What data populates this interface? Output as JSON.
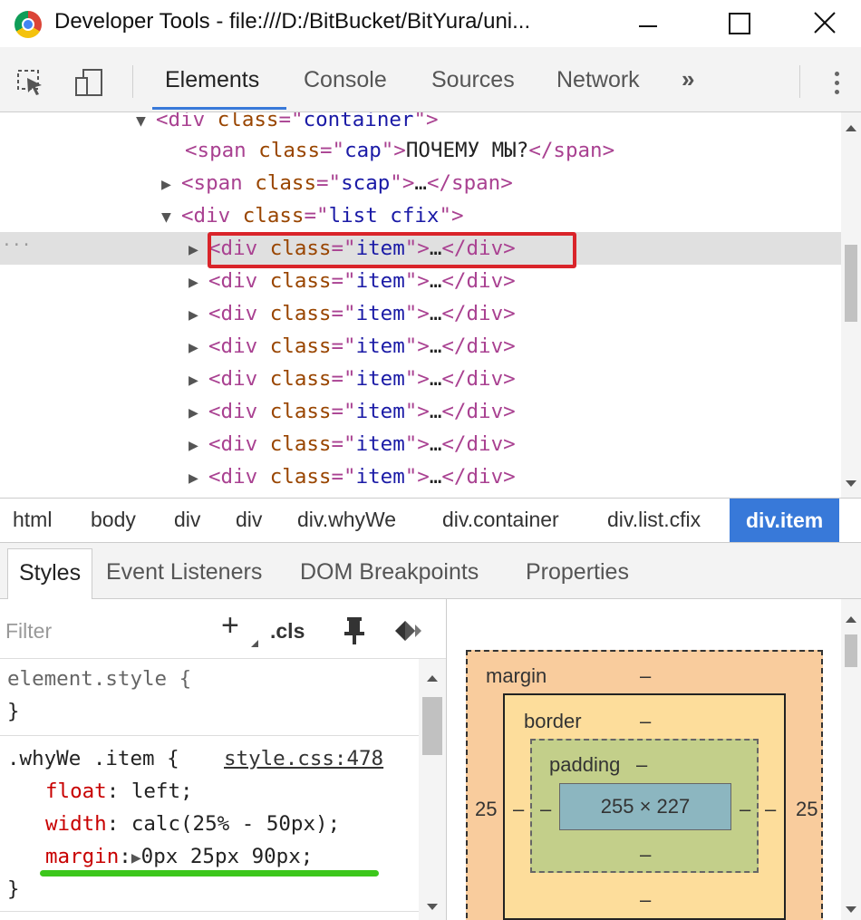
{
  "window": {
    "title": "Developer Tools - file:///D:/BitBucket/BitYura/uni...",
    "logo_icon": "chrome-logo-icon",
    "minimize_icon": "minimize-icon",
    "maximize_icon": "maximize-icon",
    "close_icon": "close-icon",
    "close_glyph": "✕"
  },
  "toolbar": {
    "tabs": [
      {
        "label": "Elements",
        "active": true
      },
      {
        "label": "Console",
        "active": false
      },
      {
        "label": "Sources",
        "active": false
      },
      {
        "label": "Network",
        "active": false
      }
    ],
    "more_tabs": "»",
    "inspect_icon": "inspect-element-icon",
    "device_icon": "device-toolbar-icon",
    "menu_icon": "kebab-menu-icon"
  },
  "dom_tree": {
    "lines": [
      {
        "indent": 150,
        "open": true,
        "parts": [
          "<div ",
          "class",
          "=\"",
          "container",
          "\">"
        ]
      },
      {
        "indent": 180,
        "text": "ПОЧЕМУ МЫ?"
      },
      {
        "indent": 180,
        "open": false
      },
      {
        "indent": 180,
        "open": true
      },
      {
        "indent": 210
      },
      {
        "indent": 210
      },
      {
        "indent": 210
      },
      {
        "indent": 210
      },
      {
        "indent": 210
      },
      {
        "indent": 210
      },
      {
        "indent": 210
      },
      {
        "indent": 210
      }
    ],
    "l0": {
      "tri": "▼",
      "open_tag": "<div ",
      "attr": "class",
      "eq": "=\"",
      "val": "container",
      "close": "\">"
    },
    "l1": {
      "open_tag": "<span ",
      "attr": "class",
      "eq": "=\"",
      "val": "cap",
      "close": "\">",
      "text": "ПОЧЕМУ МЫ?",
      "end_tag": "</span>"
    },
    "l2": {
      "tri": "▶",
      "open_tag": "<span ",
      "attr": "class",
      "eq": "=\"",
      "val": "scap",
      "close": "\">",
      "text": "…",
      "end_tag": "</span>"
    },
    "l3": {
      "tri": "▼",
      "open_tag": "<div ",
      "attr": "class",
      "eq": "=\"",
      "val": "list cfix",
      "close": "\">"
    },
    "item": {
      "tri": "▶",
      "open_tag": "<div ",
      "attr": "class",
      "eq": "=\"",
      "val": "item",
      "close": "\">",
      "text": "…",
      "end_tag": "</div>"
    },
    "selected_marker": "···"
  },
  "breadcrumbs": [
    "html",
    "body",
    "div",
    "div",
    "div.whyWe",
    "div.container",
    "div.list.cfix",
    "div.item"
  ],
  "styles_tabs": [
    "Styles",
    "Event Listeners",
    "DOM Breakpoints",
    "Properties"
  ],
  "styles": {
    "filter_placeholder": "Filter",
    "add_rule": "+",
    "cls": ".cls",
    "pin_icon": "pin-icon",
    "palette_icon": "color-palette-icon",
    "element_style_selector": "element.style {",
    "close_brace": "}",
    "rule_selector": ".whyWe .item {",
    "rule_source": "style.css:478",
    "declarations": [
      {
        "name": "float",
        "value": " left;"
      },
      {
        "name": "width",
        "value": " calc(25% - 50px);"
      },
      {
        "name": "margin",
        "value": "0px 25px 90px;",
        "expander": "▶"
      }
    ],
    "colon": ":",
    "highlight_color": "#3cc71b",
    "selection_color": "#d9242a"
  },
  "box_model": {
    "margin_label": "margin",
    "border_label": "border",
    "padding_label": "padding",
    "margin_top": "–",
    "margin_left": "25",
    "margin_right": "25",
    "margin_bottom": "–",
    "border_top": "–",
    "border_left": "–",
    "border_right": "–",
    "border_bottom": "–",
    "padding_top": "–",
    "padding_left": "–",
    "padding_right": "–",
    "padding_bottom": "–",
    "content": "255 × 227"
  }
}
